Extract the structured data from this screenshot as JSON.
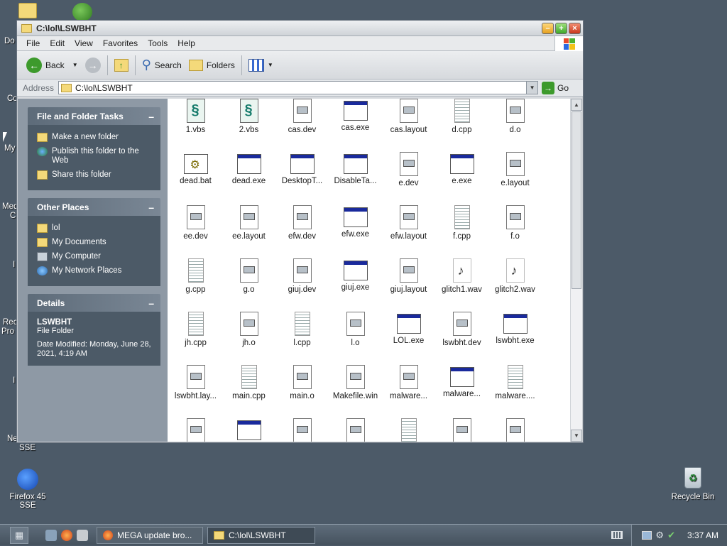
{
  "desktop": {
    "labels_left": [
      "Do",
      "Co",
      "My",
      "Med",
      "C",
      "I",
      "Rec",
      "Pro",
      "I",
      "Ne",
      "SSE"
    ],
    "firefox": {
      "name": "Firefox 45",
      "name2": "SSE"
    },
    "recycle": {
      "name": "Recycle Bin"
    }
  },
  "window": {
    "title": "C:\\lol\\LSWBHT",
    "menu": [
      "File",
      "Edit",
      "View",
      "Favorites",
      "Tools",
      "Help"
    ],
    "toolbar": {
      "back": "Back",
      "search": "Search",
      "folders": "Folders"
    },
    "address": {
      "label": "Address",
      "value": "C:\\lol\\LSWBHT",
      "go": "Go"
    }
  },
  "taskpane": {
    "file_tasks": {
      "title": "File and Folder Tasks",
      "items": [
        "Make a new folder",
        "Publish this folder to the Web",
        "Share this folder"
      ]
    },
    "other_places": {
      "title": "Other Places",
      "items": [
        "lol",
        "My Documents",
        "My Computer",
        "My Network Places"
      ]
    },
    "details": {
      "title": "Details",
      "name": "LSWBHT",
      "type": "File Folder",
      "modified": "Date Modified: Monday, June 28, 2021, 4:19 AM"
    }
  },
  "files": [
    {
      "name": "1.vbs",
      "kind": "vbs"
    },
    {
      "name": "2.vbs",
      "kind": "vbs"
    },
    {
      "name": "cas.dev",
      "kind": "doc"
    },
    {
      "name": "cas.exe",
      "kind": "exe"
    },
    {
      "name": "cas.layout",
      "kind": "doc"
    },
    {
      "name": "d.cpp",
      "kind": "txt"
    },
    {
      "name": "d.o",
      "kind": "doc"
    },
    {
      "name": "dead.bat",
      "kind": "bat"
    },
    {
      "name": "dead.exe",
      "kind": "exe"
    },
    {
      "name": "DesktopT...",
      "kind": "exe"
    },
    {
      "name": "DisableTa...",
      "kind": "exe"
    },
    {
      "name": "e.dev",
      "kind": "doc"
    },
    {
      "name": "e.exe",
      "kind": "exe"
    },
    {
      "name": "e.layout",
      "kind": "doc"
    },
    {
      "name": "ee.dev",
      "kind": "doc"
    },
    {
      "name": "ee.layout",
      "kind": "doc"
    },
    {
      "name": "efw.dev",
      "kind": "doc"
    },
    {
      "name": "efw.exe",
      "kind": "exe"
    },
    {
      "name": "efw.layout",
      "kind": "doc"
    },
    {
      "name": "f.cpp",
      "kind": "txt"
    },
    {
      "name": "f.o",
      "kind": "doc"
    },
    {
      "name": "g.cpp",
      "kind": "txt"
    },
    {
      "name": "g.o",
      "kind": "doc"
    },
    {
      "name": "giuj.dev",
      "kind": "doc"
    },
    {
      "name": "giuj.exe",
      "kind": "exe"
    },
    {
      "name": "giuj.layout",
      "kind": "doc"
    },
    {
      "name": "glitch1.wav",
      "kind": "wav"
    },
    {
      "name": "glitch2.wav",
      "kind": "wav"
    },
    {
      "name": "jh.cpp",
      "kind": "txt"
    },
    {
      "name": "jh.o",
      "kind": "doc"
    },
    {
      "name": "l.cpp",
      "kind": "txt"
    },
    {
      "name": "l.o",
      "kind": "doc"
    },
    {
      "name": "LOL.exe",
      "kind": "exe"
    },
    {
      "name": "lswbht.dev",
      "kind": "doc"
    },
    {
      "name": "lswbht.exe",
      "kind": "exe"
    },
    {
      "name": "lswbht.lay...",
      "kind": "doc"
    },
    {
      "name": "main.cpp",
      "kind": "txt"
    },
    {
      "name": "main.o",
      "kind": "doc"
    },
    {
      "name": "Makefile.win",
      "kind": "doc"
    },
    {
      "name": "malware...",
      "kind": "doc"
    },
    {
      "name": "malware...",
      "kind": "exe"
    },
    {
      "name": "malware....",
      "kind": "txt"
    },
    {
      "name": "",
      "kind": "doc"
    },
    {
      "name": "",
      "kind": "exe"
    },
    {
      "name": "",
      "kind": "doc"
    },
    {
      "name": "",
      "kind": "doc"
    },
    {
      "name": "",
      "kind": "txt"
    },
    {
      "name": "",
      "kind": "doc"
    },
    {
      "name": "",
      "kind": "doc"
    }
  ],
  "taskbar": {
    "tasks": [
      {
        "label": "MEGA update bro...",
        "active": false
      },
      {
        "label": "C:\\lol\\LSWBHT",
        "active": true
      }
    ],
    "clock": "3:37 AM"
  }
}
